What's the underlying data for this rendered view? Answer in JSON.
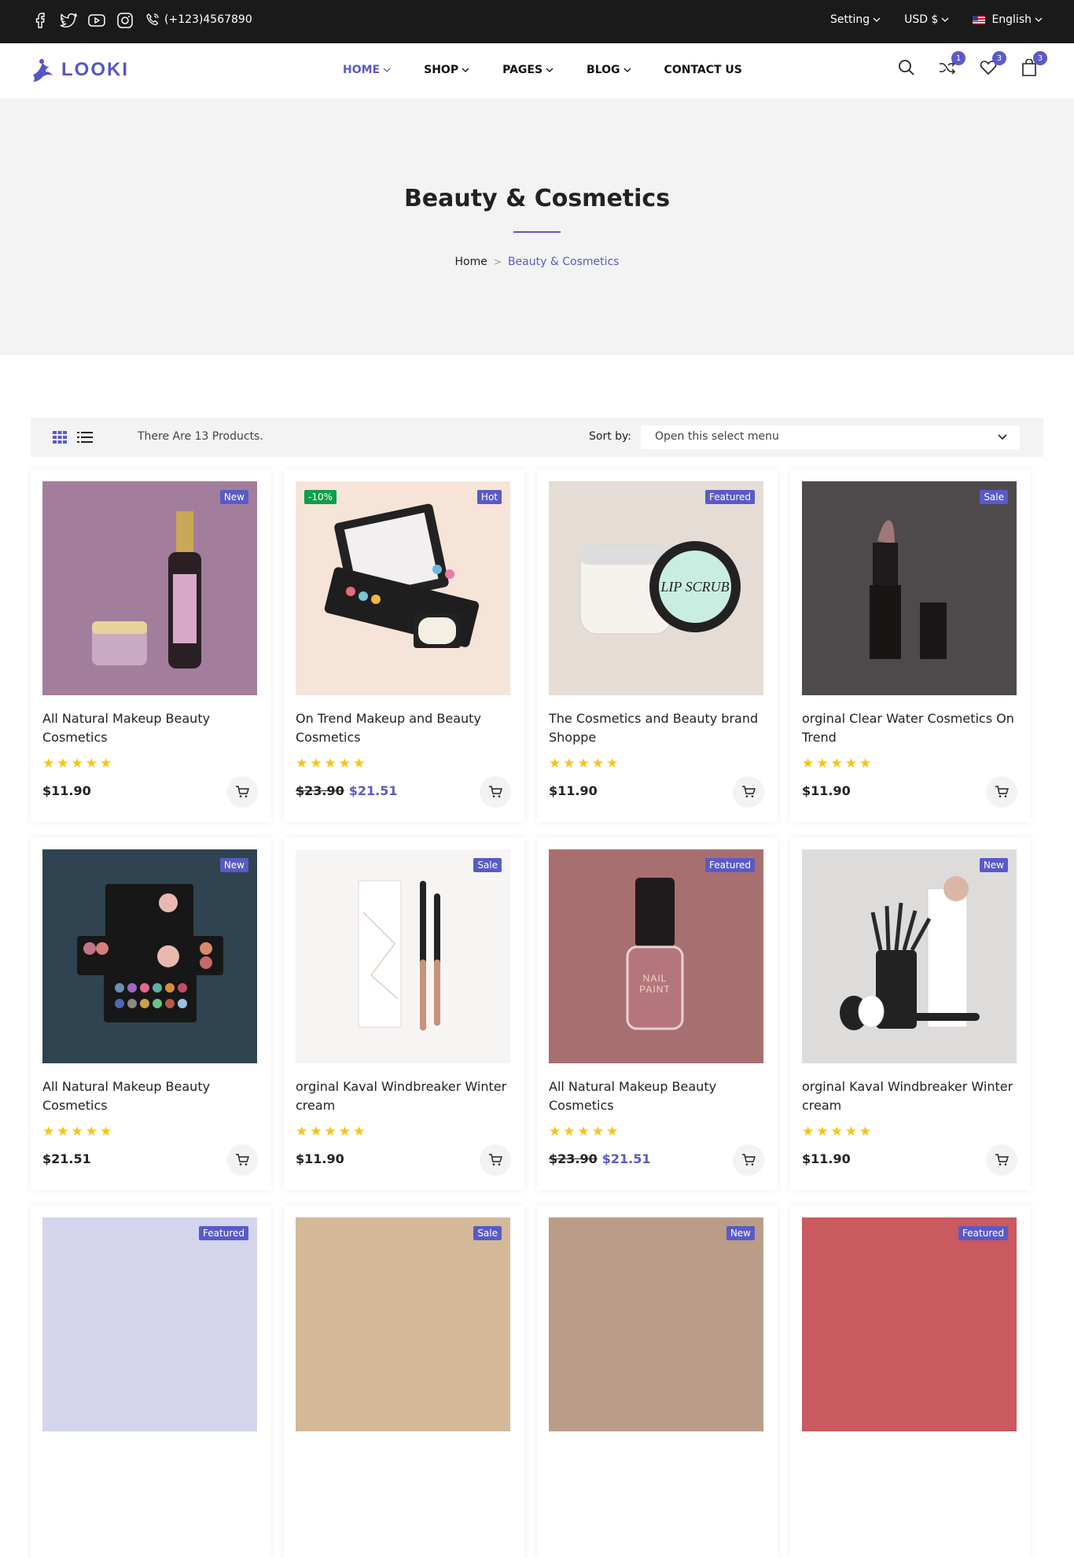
{
  "topbar": {
    "phone": "(+123)4567890",
    "setting": "Setting",
    "currency": "USD $",
    "language": "English"
  },
  "header": {
    "logo": "LOOKI",
    "nav": [
      {
        "label": "HOME"
      },
      {
        "label": "SHOP"
      },
      {
        "label": "PAGES"
      },
      {
        "label": "BLOG"
      },
      {
        "label": "CONTACT US"
      }
    ],
    "compare_count": "1",
    "wishlist_count": "3",
    "cart_count": "3"
  },
  "hero": {
    "title": "Beauty & Cosmetics",
    "breadcrumb_home": "Home",
    "breadcrumb_current": "Beauty & Cosmetics"
  },
  "toolbar": {
    "count_text": "There Are 13 Products.",
    "sort_label": "Sort by:",
    "sort_value": "Open this select menu"
  },
  "products": [
    {
      "name": "All Natural Makeup Beauty Cosmetics",
      "price": "$11.90",
      "old_price": "",
      "tag": "New",
      "tag2": "",
      "bg": "#a27e9c"
    },
    {
      "name": "On Trend Makeup and Beauty Cosmetics",
      "price": "$21.51",
      "old_price": "$23.90",
      "tag": "Hot",
      "tag2": "-10%",
      "bg": "#f7e4d8"
    },
    {
      "name": "The Cosmetics and Beauty brand Shoppe",
      "price": "$11.90",
      "old_price": "",
      "tag": "Featured",
      "tag2": "",
      "bg": "#e5ddd5"
    },
    {
      "name": "orginal Clear Water Cosmetics On Trend",
      "price": "$11.90",
      "old_price": "",
      "tag": "Sale",
      "tag2": "",
      "bg": "#4e4a4b"
    },
    {
      "name": "All Natural Makeup Beauty Cosmetics",
      "price": "$21.51",
      "old_price": "",
      "tag": "New",
      "tag2": "",
      "bg": "#2f4450"
    },
    {
      "name": "orginal Kaval Windbreaker Winter cream",
      "price": "$11.90",
      "old_price": "",
      "tag": "Sale",
      "tag2": "",
      "bg": "#f7f5f4"
    },
    {
      "name": "All Natural Makeup Beauty Cosmetics",
      "price": "$21.51",
      "old_price": "$23.90",
      "tag": "Featured",
      "tag2": "",
      "bg": "#a86f70"
    },
    {
      "name": "orginal Kaval Windbreaker Winter cream",
      "price": "$11.90",
      "old_price": "",
      "tag": "New",
      "tag2": "",
      "bg": "#dedcdb"
    },
    {
      "name": "",
      "price": "",
      "old_price": "",
      "tag": "Featured",
      "tag2": "",
      "bg": "#d4d4ec"
    },
    {
      "name": "",
      "price": "",
      "old_price": "",
      "tag": "Sale",
      "tag2": "",
      "bg": "#d4b999"
    },
    {
      "name": "",
      "price": "",
      "old_price": "",
      "tag": "New",
      "tag2": "",
      "bg": "#b99d88"
    },
    {
      "name": "",
      "price": "",
      "old_price": "",
      "tag": "Featured",
      "tag2": "",
      "bg": "#c85a60"
    }
  ],
  "product_labels": {
    "nail_paint": "NAIL PAINT",
    "lip_scrub": "LIP SCRUB"
  },
  "colors": {
    "accent": "#5a5ac8",
    "topbar": "#1a1a1a",
    "star": "#f6c31a",
    "discount": "#0d9e4a"
  }
}
